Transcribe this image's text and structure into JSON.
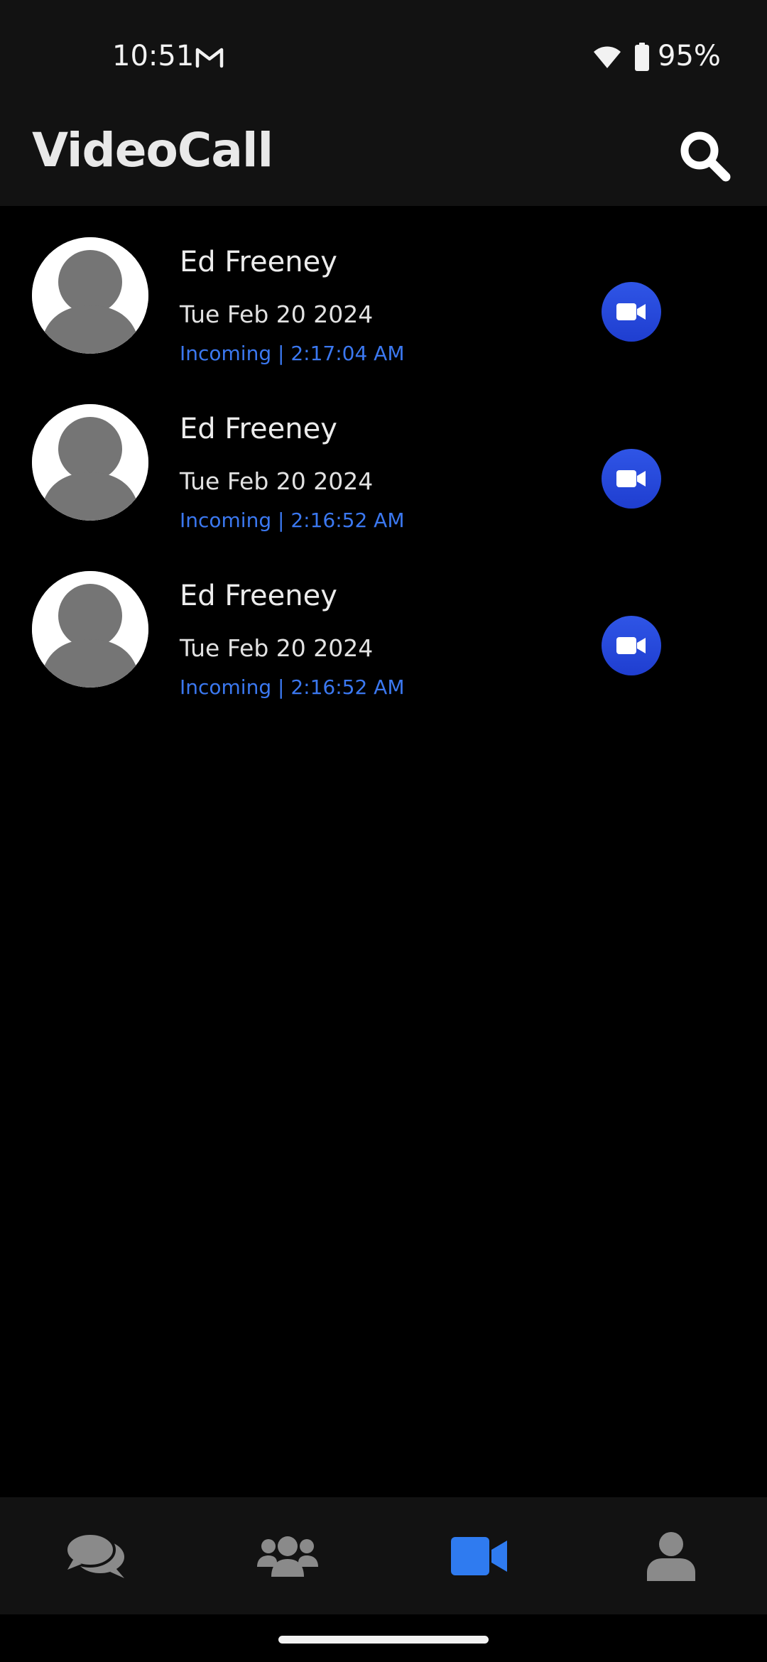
{
  "status_bar": {
    "time": "10:51",
    "battery": "95%",
    "icons": [
      "gmail-icon",
      "wifi-icon",
      "battery-icon"
    ]
  },
  "app_bar": {
    "title": "VideoCall",
    "search_icon": "search-icon"
  },
  "calls": [
    {
      "name": "Ed Freeney",
      "date": "Tue Feb 20 2024",
      "detail": "Incoming | 2:17:04 AM"
    },
    {
      "name": "Ed Freeney",
      "date": "Tue Feb 20 2024",
      "detail": "Incoming | 2:16:52 AM"
    },
    {
      "name": "Ed Freeney",
      "date": "Tue Feb 20 2024",
      "detail": "Incoming | 2:16:52 AM"
    }
  ],
  "bottom_nav": {
    "items": [
      {
        "icon": "chats-icon",
        "active": false
      },
      {
        "icon": "groups-icon",
        "active": false
      },
      {
        "icon": "video-call-icon",
        "active": true
      },
      {
        "icon": "profile-icon",
        "active": false
      }
    ]
  },
  "colors": {
    "background": "#000000",
    "bar_background": "#121212",
    "accent_blue": "#3b78f0",
    "call_button": "#2f55e6",
    "nav_inactive": "#8a8a8a",
    "nav_active": "#2f7bf0"
  }
}
